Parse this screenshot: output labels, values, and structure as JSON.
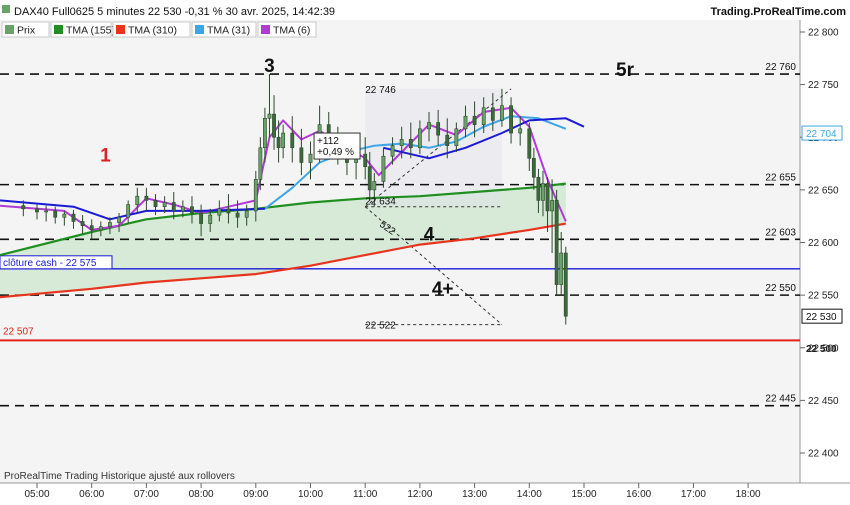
{
  "header": {
    "title": "DAX40 Full0625 5 minutes 22 530 -0,31 % 30 avr. 2025, 14:42:39",
    "brand": "Trading.ProRealTime.com"
  },
  "legend": [
    {
      "label": "Prix",
      "color": "#6aa36a"
    },
    {
      "label": "TMA (155)",
      "color": "#1f8f1f"
    },
    {
      "label": "TMA (310)",
      "color": "#e8341c"
    },
    {
      "label": "TMA (31)",
      "color": "#3ea6e6"
    },
    {
      "label": "TMA (6)",
      "color": "#b23ad6"
    }
  ],
  "footer": "ProRealTime Trading  Historique ajusté aux rollovers",
  "chart_data": {
    "type": "candlestick",
    "x_ticks": [
      "05:00",
      "06:00",
      "07:00",
      "08:00",
      "09:00",
      "10:00",
      "11:00",
      "12:00",
      "13:00",
      "14:00",
      "15:00",
      "16:00",
      "17:00",
      "18:00"
    ],
    "y_ticks": [
      22400,
      22450,
      22500,
      22550,
      22600,
      22650,
      22700,
      22750,
      22800
    ],
    "ylim": [
      22380,
      22810
    ],
    "dashed_levels": [
      {
        "value": 22760,
        "label": "22 760"
      },
      {
        "value": 22655,
        "label": "22 655"
      },
      {
        "value": 22603,
        "label": "22 603"
      },
      {
        "value": 22550,
        "label": "22 550"
      },
      {
        "value": 22445,
        "label": "22 445"
      }
    ],
    "solid_levels": [
      {
        "value": 22575,
        "label": "clôture cash -  22 575",
        "color": "#1a1ad6"
      },
      {
        "value": 22507,
        "label": "22 507",
        "color": "#e8201a"
      }
    ],
    "price_badges": [
      {
        "value": 22704,
        "label": "22 704",
        "color": "#3ea6e6"
      },
      {
        "value": 22530,
        "label": "22 530",
        "color": "#111111"
      }
    ],
    "axis_level_labels": [
      {
        "value": 22500,
        "label": "22 500"
      }
    ],
    "wave_labels": [
      {
        "text": "1",
        "time": "06:15",
        "value": 22677,
        "color": "#e02020"
      },
      {
        "text": "3",
        "time": "09:15",
        "value": 22762,
        "color": "#111111"
      },
      {
        "text": "4",
        "time": "12:10",
        "value": 22602,
        "color": "#111111"
      },
      {
        "text": "4+",
        "time": "12:25",
        "value": 22550,
        "color": "#111111"
      },
      {
        "text": "5r",
        "time": "15:45",
        "value": 22758,
        "color": "#111111"
      }
    ],
    "annotations": [
      {
        "text": "22 746",
        "time": "11:00",
        "value": 22746
      },
      {
        "text": "+112",
        "time": "10:05",
        "value": 22697
      },
      {
        "text": "+0,49 %",
        "time": "10:05",
        "value": 22686
      },
      {
        "text": "22 634",
        "time": "11:00",
        "value": 22634
      },
      {
        "text": "22 522",
        "time": "11:00",
        "value": 22522
      },
      {
        "text": "522",
        "time": "11:15",
        "value": 22616
      }
    ],
    "candles": [
      {
        "t": "04:45",
        "o": 22635,
        "h": 22640,
        "c": 22632,
        "l": 22625
      },
      {
        "t": "05:00",
        "o": 22632,
        "h": 22636,
        "c": 22629,
        "l": 22622
      },
      {
        "t": "05:10",
        "o": 22629,
        "h": 22635,
        "c": 22630,
        "l": 22620
      },
      {
        "t": "05:20",
        "o": 22630,
        "h": 22634,
        "c": 22624,
        "l": 22618
      },
      {
        "t": "05:30",
        "o": 22624,
        "h": 22630,
        "c": 22627,
        "l": 22616
      },
      {
        "t": "05:40",
        "o": 22627,
        "h": 22631,
        "c": 22620,
        "l": 22613
      },
      {
        "t": "05:50",
        "o": 22620,
        "h": 22626,
        "c": 22616,
        "l": 22608
      },
      {
        "t": "06:00",
        "o": 22616,
        "h": 22622,
        "c": 22612,
        "l": 22604
      },
      {
        "t": "06:10",
        "o": 22612,
        "h": 22620,
        "c": 22615,
        "l": 22606
      },
      {
        "t": "06:20",
        "o": 22615,
        "h": 22624,
        "c": 22619,
        "l": 22608
      },
      {
        "t": "06:30",
        "o": 22619,
        "h": 22628,
        "c": 22624,
        "l": 22610
      },
      {
        "t": "06:40",
        "o": 22624,
        "h": 22640,
        "c": 22636,
        "l": 22618
      },
      {
        "t": "06:50",
        "o": 22636,
        "h": 22652,
        "c": 22644,
        "l": 22628
      },
      {
        "t": "07:00",
        "o": 22644,
        "h": 22652,
        "c": 22640,
        "l": 22630
      },
      {
        "t": "07:10",
        "o": 22640,
        "h": 22646,
        "c": 22634,
        "l": 22626
      },
      {
        "t": "07:20",
        "o": 22634,
        "h": 22644,
        "c": 22638,
        "l": 22628
      },
      {
        "t": "07:30",
        "o": 22638,
        "h": 22648,
        "c": 22630,
        "l": 22622
      },
      {
        "t": "07:40",
        "o": 22630,
        "h": 22640,
        "c": 22634,
        "l": 22624
      },
      {
        "t": "07:50",
        "o": 22634,
        "h": 22644,
        "c": 22628,
        "l": 22618
      },
      {
        "t": "08:00",
        "o": 22628,
        "h": 22636,
        "c": 22618,
        "l": 22606
      },
      {
        "t": "08:10",
        "o": 22618,
        "h": 22632,
        "c": 22626,
        "l": 22610
      },
      {
        "t": "08:20",
        "o": 22626,
        "h": 22640,
        "c": 22632,
        "l": 22620
      },
      {
        "t": "08:30",
        "o": 22632,
        "h": 22646,
        "c": 22628,
        "l": 22618
      },
      {
        "t": "08:40",
        "o": 22628,
        "h": 22640,
        "c": 22624,
        "l": 22614
      },
      {
        "t": "08:50",
        "o": 22624,
        "h": 22636,
        "c": 22630,
        "l": 22616
      },
      {
        "t": "09:00",
        "o": 22630,
        "h": 22668,
        "c": 22660,
        "l": 22620
      },
      {
        "t": "09:05",
        "o": 22660,
        "h": 22700,
        "c": 22690,
        "l": 22650
      },
      {
        "t": "09:10",
        "o": 22690,
        "h": 22728,
        "c": 22718,
        "l": 22676
      },
      {
        "t": "09:15",
        "o": 22718,
        "h": 22760,
        "c": 22722,
        "l": 22700
      },
      {
        "t": "09:20",
        "o": 22722,
        "h": 22740,
        "c": 22700,
        "l": 22688
      },
      {
        "t": "09:25",
        "o": 22700,
        "h": 22716,
        "c": 22690,
        "l": 22676
      },
      {
        "t": "09:30",
        "o": 22690,
        "h": 22712,
        "c": 22704,
        "l": 22680
      },
      {
        "t": "09:40",
        "o": 22704,
        "h": 22720,
        "c": 22690,
        "l": 22676
      },
      {
        "t": "09:50",
        "o": 22690,
        "h": 22708,
        "c": 22676,
        "l": 22664
      },
      {
        "t": "10:00",
        "o": 22676,
        "h": 22696,
        "c": 22684,
        "l": 22660
      },
      {
        "t": "10:10",
        "o": 22684,
        "h": 22730,
        "c": 22712,
        "l": 22676
      },
      {
        "t": "10:20",
        "o": 22712,
        "h": 22724,
        "c": 22694,
        "l": 22680
      },
      {
        "t": "10:30",
        "o": 22694,
        "h": 22710,
        "c": 22688,
        "l": 22674
      },
      {
        "t": "10:40",
        "o": 22688,
        "h": 22700,
        "c": 22676,
        "l": 22664
      },
      {
        "t": "10:50",
        "o": 22676,
        "h": 22694,
        "c": 22684,
        "l": 22660
      },
      {
        "t": "11:00",
        "o": 22684,
        "h": 22700,
        "c": 22672,
        "l": 22660
      },
      {
        "t": "11:05",
        "o": 22672,
        "h": 22686,
        "c": 22650,
        "l": 22640
      },
      {
        "t": "11:10",
        "o": 22650,
        "h": 22666,
        "c": 22658,
        "l": 22634
      },
      {
        "t": "11:20",
        "o": 22658,
        "h": 22690,
        "c": 22682,
        "l": 22652
      },
      {
        "t": "11:30",
        "o": 22682,
        "h": 22700,
        "c": 22692,
        "l": 22674
      },
      {
        "t": "11:40",
        "o": 22692,
        "h": 22710,
        "c": 22698,
        "l": 22680
      },
      {
        "t": "11:50",
        "o": 22698,
        "h": 22714,
        "c": 22690,
        "l": 22680
      },
      {
        "t": "12:00",
        "o": 22690,
        "h": 22716,
        "c": 22708,
        "l": 22684
      },
      {
        "t": "12:10",
        "o": 22708,
        "h": 22724,
        "c": 22714,
        "l": 22696
      },
      {
        "t": "12:20",
        "o": 22714,
        "h": 22726,
        "c": 22702,
        "l": 22692
      },
      {
        "t": "12:30",
        "o": 22702,
        "h": 22718,
        "c": 22692,
        "l": 22680
      },
      {
        "t": "12:40",
        "o": 22692,
        "h": 22714,
        "c": 22708,
        "l": 22686
      },
      {
        "t": "12:50",
        "o": 22708,
        "h": 22730,
        "c": 22720,
        "l": 22700
      },
      {
        "t": "13:00",
        "o": 22720,
        "h": 22734,
        "c": 22712,
        "l": 22700
      },
      {
        "t": "13:10",
        "o": 22712,
        "h": 22738,
        "c": 22728,
        "l": 22704
      },
      {
        "t": "13:20",
        "o": 22728,
        "h": 22742,
        "c": 22716,
        "l": 22706
      },
      {
        "t": "13:30",
        "o": 22716,
        "h": 22746,
        "c": 22730,
        "l": 22710
      },
      {
        "t": "13:40",
        "o": 22730,
        "h": 22738,
        "c": 22704,
        "l": 22694
      },
      {
        "t": "13:50",
        "o": 22704,
        "h": 22720,
        "c": 22708,
        "l": 22692
      },
      {
        "t": "14:00",
        "o": 22708,
        "h": 22714,
        "c": 22680,
        "l": 22668
      },
      {
        "t": "14:05",
        "o": 22680,
        "h": 22690,
        "c": 22662,
        "l": 22650
      },
      {
        "t": "14:10",
        "o": 22662,
        "h": 22670,
        "c": 22640,
        "l": 22628
      },
      {
        "t": "14:15",
        "o": 22640,
        "h": 22668,
        "c": 22656,
        "l": 22625
      },
      {
        "t": "14:20",
        "o": 22656,
        "h": 22662,
        "c": 22630,
        "l": 22610
      },
      {
        "t": "14:25",
        "o": 22630,
        "h": 22660,
        "c": 22640,
        "l": 22590
      },
      {
        "t": "14:30",
        "o": 22640,
        "h": 22650,
        "c": 22560,
        "l": 22550
      },
      {
        "t": "14:35",
        "o": 22560,
        "h": 22610,
        "c": 22590,
        "l": 22550
      },
      {
        "t": "14:40",
        "o": 22590,
        "h": 22596,
        "c": 22530,
        "l": 22522
      }
    ],
    "series": [
      {
        "name": "TMA (155)",
        "color": "#1f8f1f",
        "points": [
          [
            "04:40",
            22588
          ],
          [
            "06:00",
            22610
          ],
          [
            "07:00",
            22622
          ],
          [
            "08:00",
            22628
          ],
          [
            "09:00",
            22632
          ],
          [
            "10:00",
            22638
          ],
          [
            "11:00",
            22642
          ],
          [
            "12:00",
            22644
          ],
          [
            "13:00",
            22648
          ],
          [
            "14:00",
            22652
          ],
          [
            "14:40",
            22656
          ]
        ]
      },
      {
        "name": "TMA (310)",
        "color": "#e8341c",
        "points": [
          [
            "04:40",
            22548
          ],
          [
            "06:00",
            22556
          ],
          [
            "07:00",
            22562
          ],
          [
            "08:00",
            22566
          ],
          [
            "09:00",
            22570
          ],
          [
            "10:00",
            22578
          ],
          [
            "11:00",
            22588
          ],
          [
            "12:00",
            22598
          ],
          [
            "13:00",
            22604
          ],
          [
            "14:00",
            22612
          ],
          [
            "14:40",
            22618
          ]
        ]
      },
      {
        "name": "TMA (31)",
        "color": "#3ea6e6",
        "points": [
          [
            "09:10",
            22632
          ],
          [
            "09:40",
            22652
          ],
          [
            "10:10",
            22676
          ],
          [
            "10:40",
            22686
          ],
          [
            "11:10",
            22692
          ],
          [
            "11:40",
            22694
          ],
          [
            "12:10",
            22690
          ],
          [
            "12:40",
            22696
          ],
          [
            "13:10",
            22710
          ],
          [
            "13:40",
            22720
          ],
          [
            "14:10",
            22718
          ],
          [
            "14:40",
            22708
          ]
        ]
      },
      {
        "name": "TMA (6)",
        "color": "#b23ad6",
        "points": [
          [
            "04:40",
            22635
          ],
          [
            "05:30",
            22630
          ],
          [
            "06:00",
            22612
          ],
          [
            "06:30",
            22616
          ],
          [
            "07:00",
            22642
          ],
          [
            "07:30",
            22636
          ],
          [
            "08:00",
            22628
          ],
          [
            "08:30",
            22634
          ],
          [
            "09:00",
            22640
          ],
          [
            "09:15",
            22700
          ],
          [
            "09:30",
            22716
          ],
          [
            "09:50",
            22698
          ],
          [
            "10:10",
            22706
          ],
          [
            "10:40",
            22690
          ],
          [
            "11:00",
            22680
          ],
          [
            "11:15",
            22664
          ],
          [
            "11:40",
            22686
          ],
          [
            "12:10",
            22712
          ],
          [
            "12:40",
            22702
          ],
          [
            "13:10",
            22724
          ],
          [
            "13:40",
            22728
          ],
          [
            "14:00",
            22710
          ],
          [
            "14:20",
            22660
          ],
          [
            "14:40",
            22620
          ]
        ]
      },
      {
        "name": "TMA (31) extension",
        "color": "#1a1ad6",
        "points": [
          [
            "04:40",
            22640
          ],
          [
            "05:40",
            22634
          ],
          [
            "06:20",
            22622
          ],
          [
            "07:00",
            22630
          ],
          [
            "08:00",
            22630
          ],
          [
            "09:10",
            22632
          ]
        ]
      },
      {
        "name": "TMA (31) extension 2",
        "color": "#1a1ad6",
        "points": [
          [
            "11:20",
            22690
          ],
          [
            "12:10",
            22680
          ],
          [
            "12:50",
            22690
          ],
          [
            "13:30",
            22704
          ],
          [
            "14:00",
            22716
          ],
          [
            "14:40",
            22718
          ],
          [
            "15:00",
            22710
          ]
        ]
      }
    ]
  }
}
